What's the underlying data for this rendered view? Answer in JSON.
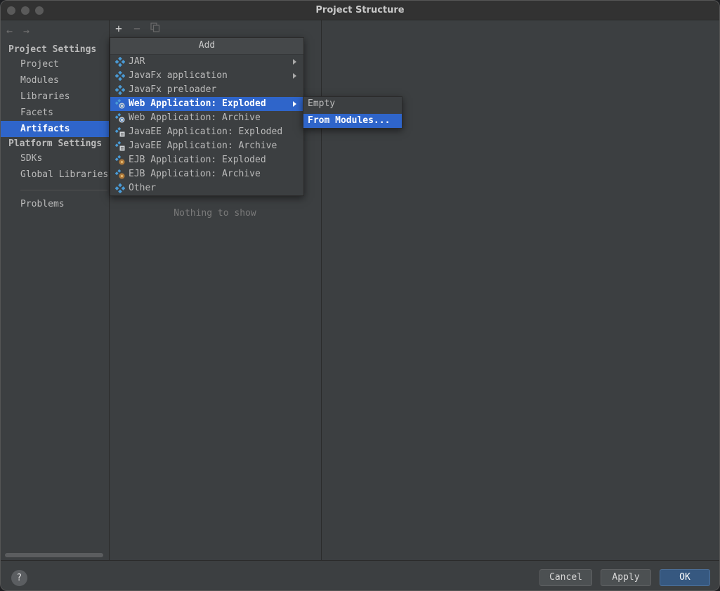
{
  "window": {
    "title": "Project Structure"
  },
  "sidebar": {
    "project_settings_header": "Project Settings",
    "project_items": [
      {
        "label": "Project"
      },
      {
        "label": "Modules"
      },
      {
        "label": "Libraries"
      },
      {
        "label": "Facets"
      },
      {
        "label": "Artifacts",
        "selected": true
      }
    ],
    "platform_settings_header": "Platform Settings",
    "platform_items": [
      {
        "label": "SDKs"
      },
      {
        "label": "Global Libraries"
      }
    ],
    "problems_label": "Problems"
  },
  "toolbar": {
    "add_icon": "plus-icon",
    "remove_icon": "minus-icon",
    "copy_icon": "copy-icon"
  },
  "middle": {
    "empty_text": "Nothing to show"
  },
  "add_menu": {
    "title": "Add",
    "items": [
      {
        "label": "JAR",
        "icon": "artifact-icon",
        "submenu": true
      },
      {
        "label": "JavaFx application",
        "icon": "artifact-icon",
        "submenu": true
      },
      {
        "label": "JavaFx preloader",
        "icon": "artifact-icon",
        "submenu": false
      },
      {
        "label": "Web Application: Exploded",
        "icon": "web-artifact-icon",
        "submenu": true,
        "active": true
      },
      {
        "label": "Web Application: Archive",
        "icon": "web-artifact-icon",
        "submenu": false
      },
      {
        "label": "JavaEE Application: Exploded",
        "icon": "javaee-artifact-icon",
        "submenu": false
      },
      {
        "label": "JavaEE Application: Archive",
        "icon": "javaee-artifact-icon",
        "submenu": false
      },
      {
        "label": "EJB Application: Exploded",
        "icon": "ejb-artifact-icon",
        "submenu": false
      },
      {
        "label": "EJB Application: Archive",
        "icon": "ejb-artifact-icon",
        "submenu": false
      },
      {
        "label": "Other",
        "icon": "artifact-icon",
        "submenu": false
      }
    ]
  },
  "submenu": {
    "items": [
      {
        "label": "Empty"
      },
      {
        "label": "From Modules...",
        "active": true
      }
    ]
  },
  "footer": {
    "help_label": "?",
    "cancel_label": "Cancel",
    "apply_label": "Apply",
    "ok_label": "OK"
  },
  "colors": {
    "selection": "#2f65ca",
    "background": "#3c3f41",
    "primary_button": "#365880",
    "artifact_icon": "#4a9bd6"
  }
}
